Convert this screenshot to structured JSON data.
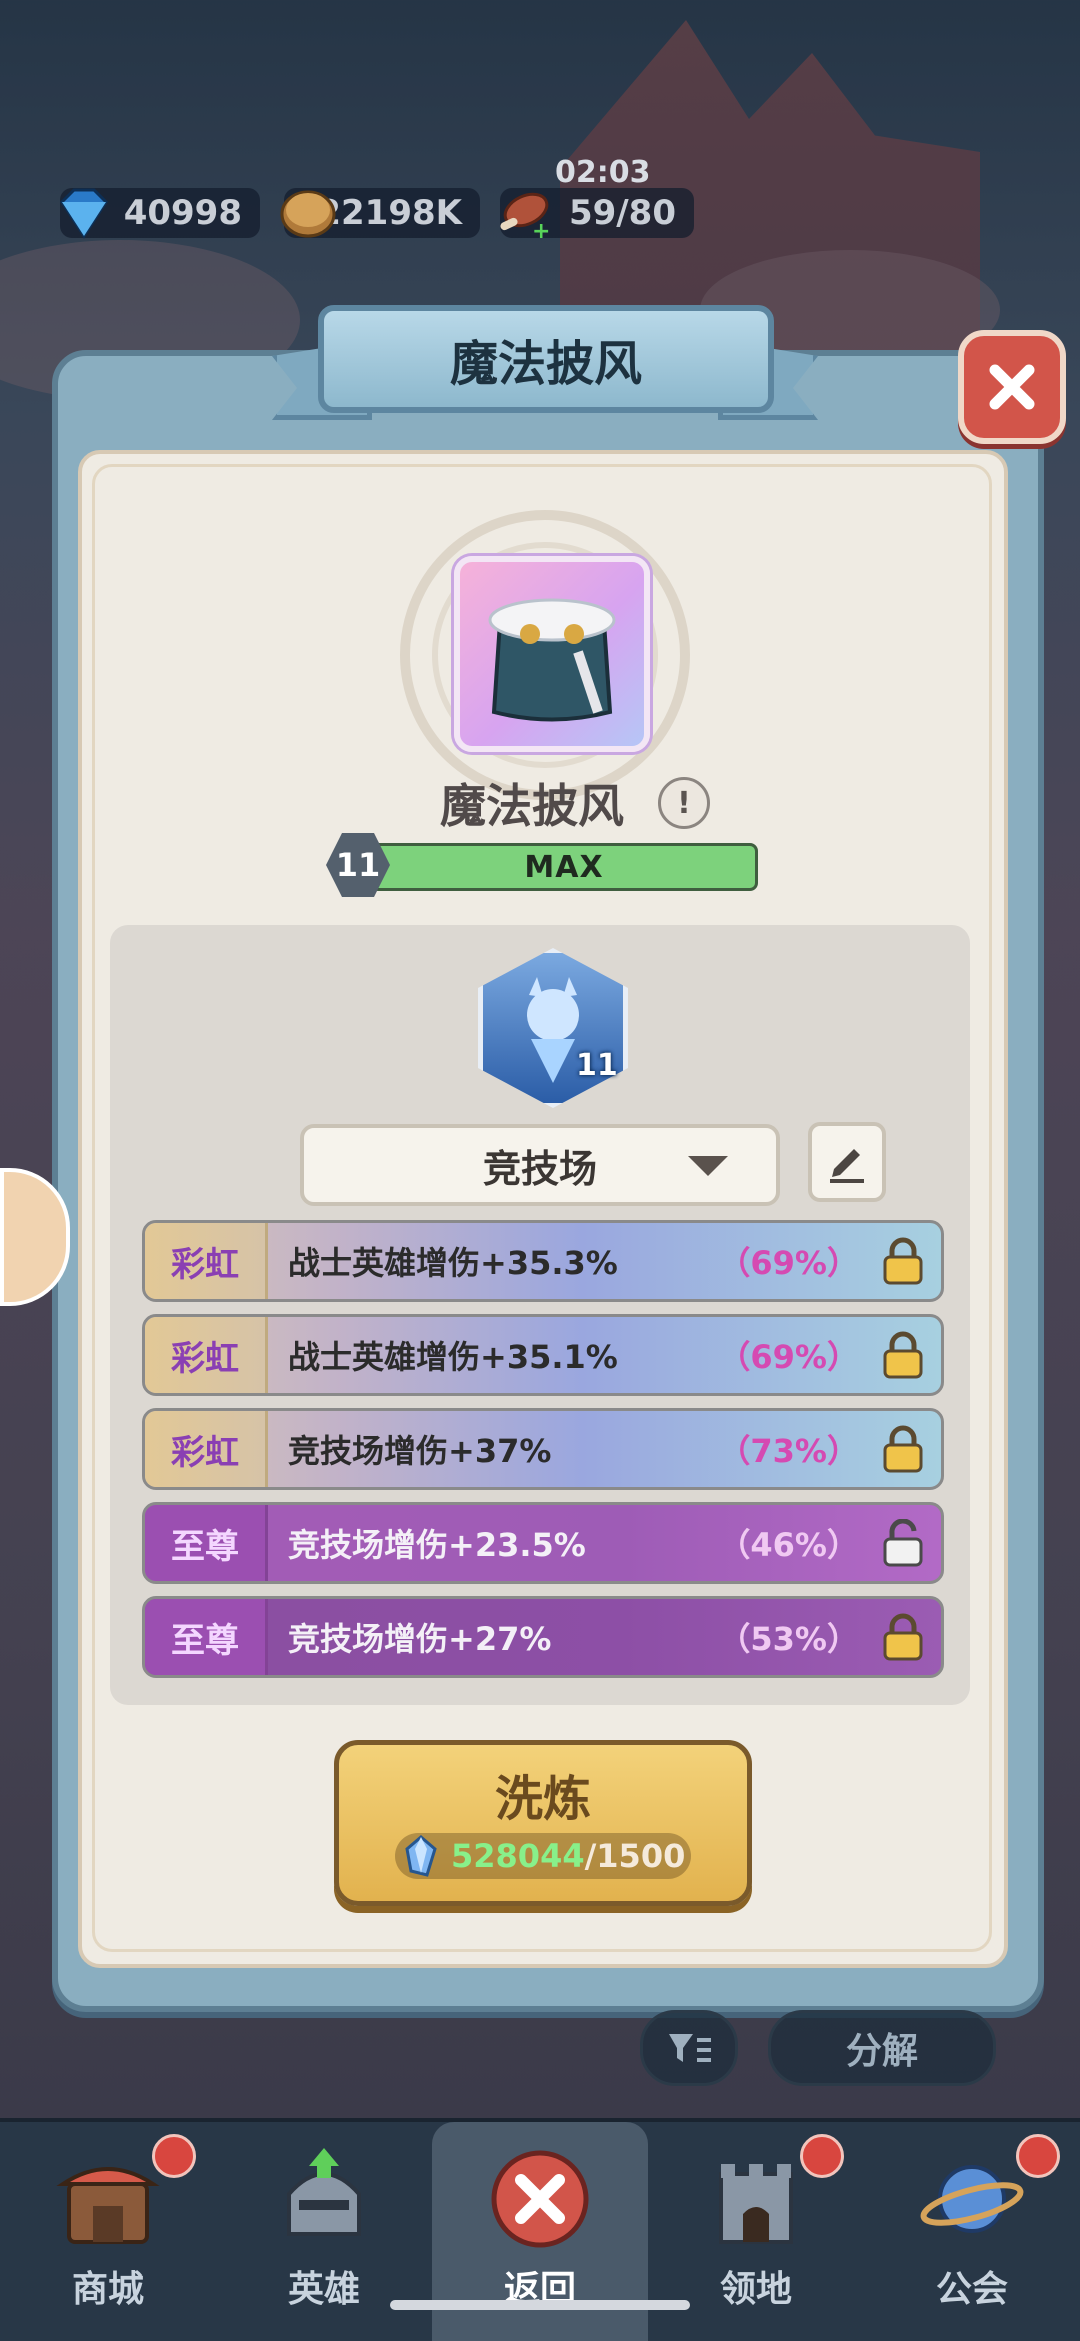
{
  "resources": {
    "gems": "40998",
    "coins": "22198K",
    "stamina": "59/80",
    "stamina_timer": "02:03"
  },
  "dialog": {
    "title": "魔法披风",
    "item_name": "魔法披风",
    "level": "11",
    "level_bar_label": "MAX",
    "skill_level": "11",
    "preset_select": "竞技场",
    "stats": [
      {
        "tier": "彩虹",
        "text": "战士英雄增伤+35.3%",
        "percent": "（69%）",
        "locked": true
      },
      {
        "tier": "彩虹",
        "text": "战士英雄增伤+35.1%",
        "percent": "（69%）",
        "locked": true
      },
      {
        "tier": "彩虹",
        "text": "竞技场增伤+37%",
        "percent": "（73%）",
        "locked": true
      },
      {
        "tier": "至尊",
        "text": "竞技场增伤+23.5%",
        "percent": "（46%）",
        "locked": false
      },
      {
        "tier": "至尊",
        "text": "竞技场增伤+27%",
        "percent": "（53%）",
        "locked": true
      }
    ],
    "refine_button": "洗炼",
    "cost_have": "528044",
    "cost_need": "/1500"
  },
  "background_buttons": {
    "decompose": "分解"
  },
  "nav": [
    {
      "label": "商城",
      "badge": true
    },
    {
      "label": "英雄",
      "badge": false
    },
    {
      "label": "返回",
      "badge": false,
      "active": true
    },
    {
      "label": "领地",
      "badge": true
    },
    {
      "label": "公会",
      "badge": true
    }
  ]
}
